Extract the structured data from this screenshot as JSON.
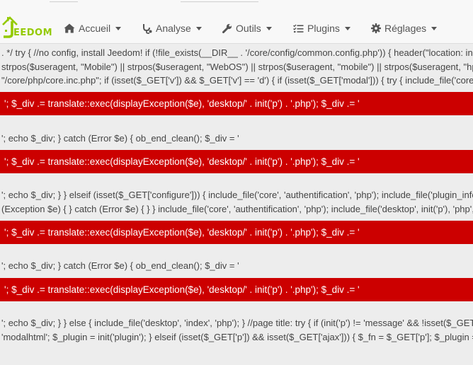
{
  "logo": {
    "text": "EEDOM"
  },
  "menu": [
    {
      "label": "Accueil",
      "icon": "home-icon"
    },
    {
      "label": "Analyse",
      "icon": "stethoscope-icon"
    },
    {
      "label": "Outils",
      "icon": "wrench-icon"
    },
    {
      "label": "Plugins",
      "icon": "tasks-list-icon"
    },
    {
      "label": "Réglages",
      "icon": "gear-icon"
    }
  ],
  "code_lines": [
    ". */ try { //no config, install Jeedom! if (!file_exists(__DIR__ . '/core/config/common.config.php')) { header(\"location: install/setup.php\"); } if (!isset($_GET['v'])) { $useragent = (isset($_SERVER[\"HTTP_USER_AGENT\"])) ? $_SERVER[\"HTTP_USER_AGENT\"] : 'none'; $getParams = (",
    "strpos($useragent, \"Mobile\") || strpos($useragent, \"WebOS\") || strpos($useragent, \"mobile\") || strpos($useragent, \"hp-tablet\")) ? 'm' : 'd'; foreach ($_GET AS $var => $value) { $getParams .= '&' . $var . '=' . $value; } $url = 'index.php?v=' . trim($getParams, '&');",
    "\"/core/php/core.inc.php\"; if (isset($_GET['v']) && $_GET['v'] == 'd') { if (isset($_GET['modal'])) { try { include_file('core', 'authentification', 'php'); include_file('desktop', init('modal'), 'modal', init('plugin')); } catch (Exception $e) { ob_end_clean(); $_div = '",
    "'; echo $_div; } catch (Error $e) { ob_end_clean(); $_div = '",
    "'; echo $_div; } } elseif (isset($_GET['configure'])) { include_file('core', 'authentification', 'php'); include_file('plugin_info', 'configuration', 'configuration', init('plugin')); } elseif (isset($_GET['ajax']) && $_GET['ajax'] == 1) { try { $title = 'Jeedom'; if (isset(",
    "(Exception $e) { } catch (Error $e) { } } include_file('core', 'authentification', 'php'); include_file('desktop', init('p'), 'php', init('m')); } catch (Exception $e) { ob_end_clean(); $_div = '",
    "'; echo $_div; } catch (Error $e) { ob_end_clean(); $_div = '",
    "'; echo $_div; } } else { include_file('desktop', 'index', 'php'); } //page title: try { if (init('p') != 'message' && !isset($_GET['configure']) && !isset($_GET['modal'])) { $title = pageTitle(init('p')) . ' - ' . config::byKey('product_name'); echo '<script>document.title = \"",
    "'modalhtml'; $_plugin = init('plugin'); } elseif (isset($_GET['p']) && isset($_GET['ajax'])) { $_fn = $_GET['p']; $_plugin = isset($_GET['m']) ? $_GET['m'] : $_plugin; } else { $_fn = 'index.php'; $_plugin = ''; }"
  ],
  "error_text": "'; $_div .= translate::exec(displayException($e), 'desktop/' . init('p') . '.php'); $_div .= '"
}
